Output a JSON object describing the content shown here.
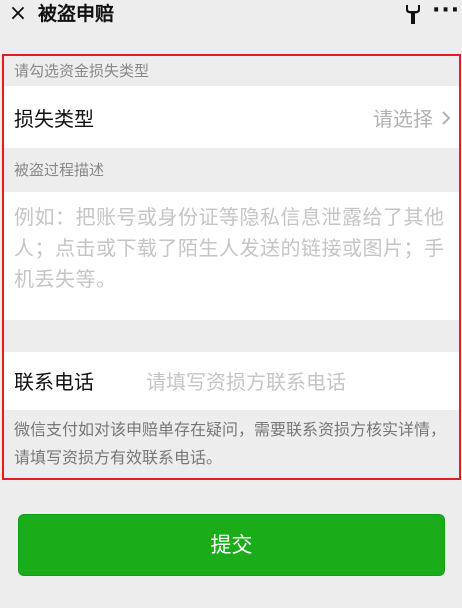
{
  "nav": {
    "close_label": "×",
    "title": "被盗申赔",
    "more_label": "···"
  },
  "form": {
    "type_section_label": "请勾选资金损失类型",
    "loss_type_label": "损失类型",
    "loss_type_value": "请选择",
    "desc_section_label": "被盗过程描述",
    "desc_placeholder": "例如：把账号或身份证等隐私信息泄露给了其他人；点击或下载了陌生人发送的链接或图片；手机丢失等。",
    "phone_label": "联系电话",
    "phone_placeholder": "请填写资损方联系电话",
    "note": "微信支付如对该申赔单存在疑问，需要联系资损方核实详情，请填写资损方有效联系电话。"
  },
  "submit_label": "提交",
  "colors": {
    "primary_button": "#1aad19",
    "highlight_border": "#e02020",
    "background": "#ededed"
  }
}
